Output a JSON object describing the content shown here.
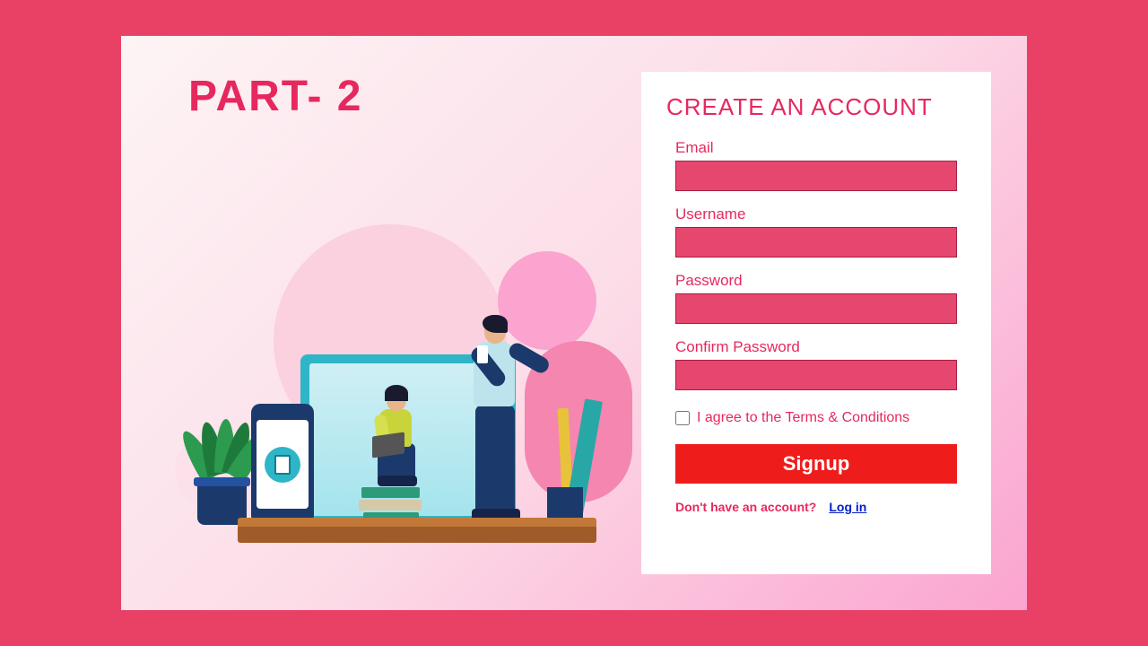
{
  "hero": {
    "part_title": "PART- 2"
  },
  "form": {
    "title": "CREATE AN ACCOUNT",
    "fields": {
      "email": {
        "label": "Email",
        "value": ""
      },
      "username": {
        "label": "Username",
        "value": ""
      },
      "password": {
        "label": "Password",
        "value": ""
      },
      "confirm": {
        "label": "Confirm Password",
        "value": ""
      }
    },
    "terms_label": "I agree to the Terms & Conditions",
    "submit_label": "Signup",
    "footer_text": "Don't have an account?",
    "footer_link": "Log in"
  }
}
